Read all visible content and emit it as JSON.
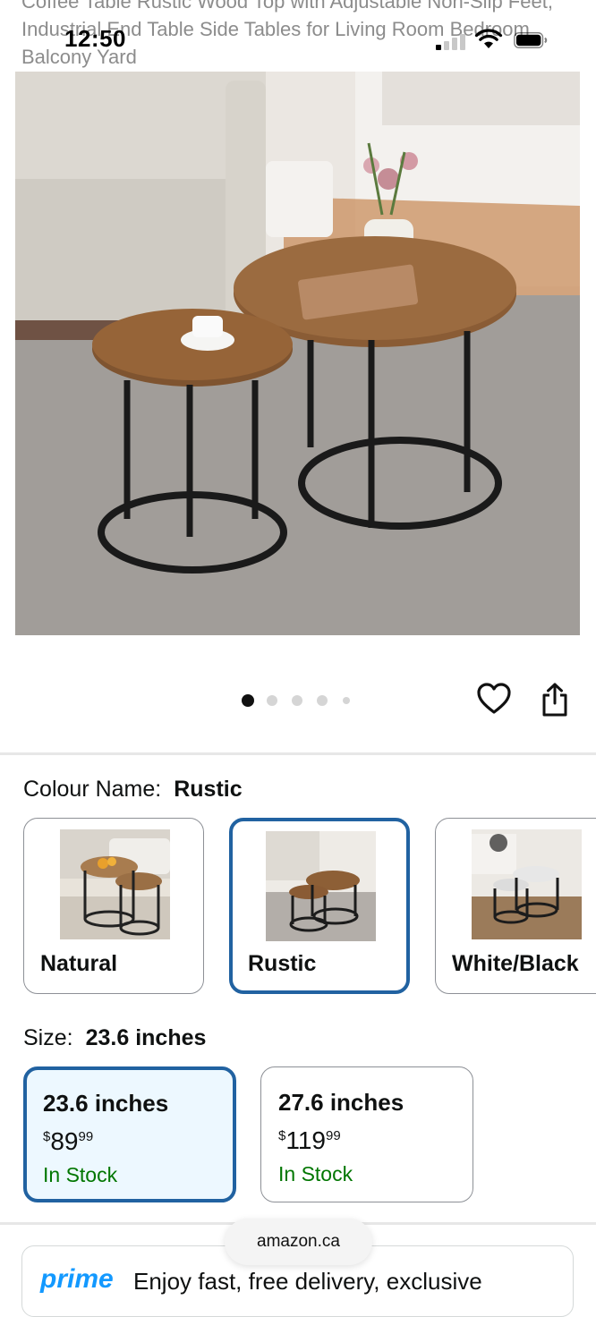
{
  "page": {
    "title_text": "Coffee Table Rustic Wood Top with Adjustable Non-Slip Feet, Industrial End Table Side Tables for Living Room Bedroom Balcony Yard"
  },
  "status_bar": {
    "time": "12:50"
  },
  "gallery": {
    "image_count": 5,
    "active_index": 0,
    "main_image": "nesting-round-coffee-tables-photo"
  },
  "actions": {
    "wishlist_icon": "heart-icon",
    "share_icon": "share-icon"
  },
  "colour": {
    "label": "Colour Name:",
    "selected": "Rustic",
    "options": [
      {
        "label": "Natural"
      },
      {
        "label": "Rustic"
      },
      {
        "label": "White/Black"
      }
    ]
  },
  "size": {
    "label": "Size:",
    "selected": "23.6 inches",
    "options": [
      {
        "label": "23.6 inches",
        "currency": "$",
        "price_whole": "89",
        "price_cents": "99",
        "stock": "In Stock"
      },
      {
        "label": "27.6 inches",
        "currency": "$",
        "price_whole": "119",
        "price_cents": "99",
        "stock": "In Stock"
      }
    ]
  },
  "browser": {
    "url": "amazon.ca"
  },
  "prime": {
    "logo": "prime",
    "text": "Enjoy fast, free delivery, exclusive"
  },
  "colors": {
    "accent": "#2162a1",
    "in_stock": "#007600",
    "prime": "#1399ff",
    "selected_bg": "#edf8ff"
  }
}
